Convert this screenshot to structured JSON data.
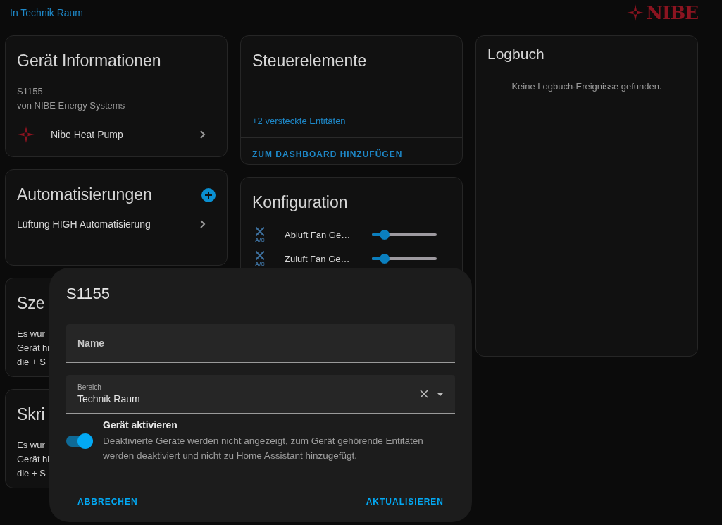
{
  "breadcrumb": "In Technik Raum",
  "logo": {
    "text": "NIBE"
  },
  "device_info": {
    "title": "Gerät Informationen",
    "model": "S1155",
    "manufacturer": "von NIBE Energy Systems",
    "integration": "Nibe Heat Pump"
  },
  "automations": {
    "title": "Automatisierungen",
    "items": [
      "Lüftung HIGH Automatisierung"
    ]
  },
  "scenes": {
    "title": "Sze",
    "lines": [
      "Es wur",
      "Gerät hi",
      "die + S"
    ]
  },
  "scripts": {
    "title": "Skri",
    "lines": [
      "Es wur",
      "Gerät hi",
      "die + S"
    ]
  },
  "controls": {
    "title": "Steuerelemente",
    "hidden_link": "+2 versteckte Entitäten",
    "action": "ZUM DASHBOARD HINZUFÜGEN"
  },
  "configuration": {
    "title": "Konfiguration",
    "rows": [
      {
        "icon_text": "A/C",
        "label": "Abluft Fan Ge…",
        "level": 0.2
      },
      {
        "icon_text": "A/C",
        "label": "Zuluft Fan Ge…",
        "level": 0.2
      }
    ]
  },
  "logbook": {
    "title": "Logbuch",
    "empty": "Keine Logbuch-Ereignisse gefunden."
  },
  "dialog": {
    "title": "S1155",
    "name_field": {
      "placeholder": "Name"
    },
    "area_field": {
      "label": "Bereich",
      "value": "Technik Raum"
    },
    "enable": {
      "title": "Gerät aktivieren",
      "description": "Deaktivierte Geräte werden nicht angezeigt, zum Gerät gehörende Entitäten werden deaktiviert und nicht zu Home Assistant hinzugefügt.",
      "on": true
    },
    "buttons": [
      "ABBRECHEN",
      "AKTUALISIEREN"
    ]
  }
}
